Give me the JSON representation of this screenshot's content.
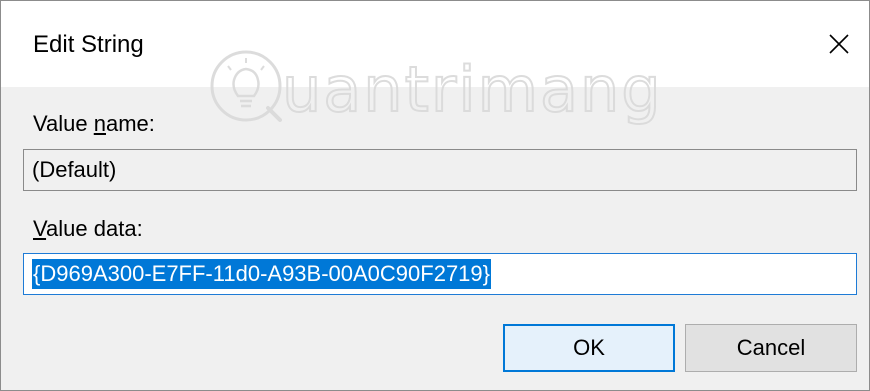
{
  "window": {
    "title": "Edit String",
    "close_icon": "close-icon"
  },
  "watermark": {
    "text": "uantrimang",
    "logo_icon": "lightbulb-q-logo"
  },
  "form": {
    "value_name_label_underline": "n",
    "value_name_label_pre": "Value ",
    "value_name_label_post": "ame:",
    "value_name": "(Default)",
    "value_data_label_underline": "V",
    "value_data_label_post": "alue data:",
    "value_data": "{D969A300-E7FF-11d0-A93B-00A0C90F2719}"
  },
  "buttons": {
    "ok_label": "OK",
    "cancel_label": "Cancel"
  },
  "colors": {
    "accent": "#0078d7",
    "dialog_bg": "#f0f0f0",
    "title_bg": "#ffffff"
  }
}
